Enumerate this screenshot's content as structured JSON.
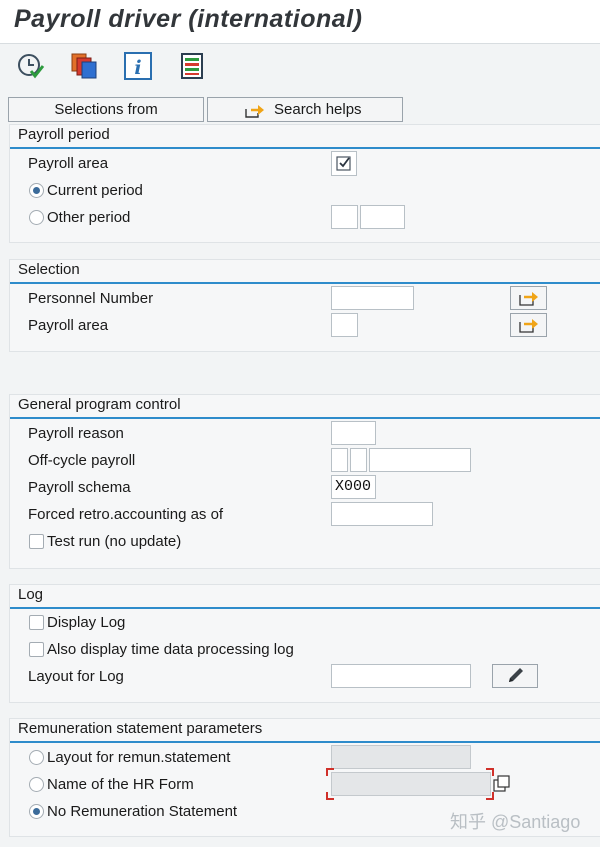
{
  "title": "Payroll driver (international)",
  "toolbar": {
    "icons": [
      "execute-clock-icon",
      "copy-variant-icon",
      "info-icon",
      "list-icon"
    ]
  },
  "buttons": {
    "selections_from": "Selections from",
    "search_helps": "Search helps"
  },
  "payroll_period": {
    "title": "Payroll period",
    "payroll_area_label": "Payroll area",
    "payroll_area_checked": true,
    "current_period_label": "Current period",
    "current_period_selected": true,
    "other_period_label": "Other period",
    "other_period_selected": false,
    "other_period_value1": "",
    "other_period_value2": ""
  },
  "selection": {
    "title": "Selection",
    "personnel_number_label": "Personnel Number",
    "personnel_number_value": "",
    "payroll_area_label": "Payroll area",
    "payroll_area_value": ""
  },
  "general": {
    "title": "General program control",
    "payroll_reason_label": "Payroll reason",
    "payroll_reason_value": "",
    "off_cycle_label": "Off-cycle payroll",
    "schema_label": "Payroll schema",
    "schema_value": "X000",
    "forced_retro_label": "Forced retro.accounting as of",
    "forced_retro_value": "",
    "test_run_label": "Test run (no update)",
    "test_run_checked": false
  },
  "log": {
    "title": "Log",
    "display_log_label": "Display Log",
    "display_log_checked": false,
    "time_log_label": "Also display time data processing log",
    "time_log_checked": false,
    "layout_label": "Layout for Log",
    "layout_value": ""
  },
  "remuneration": {
    "title": "Remuneration statement parameters",
    "layout_label": "Layout for remun.statement",
    "layout_selected": false,
    "hr_form_label": "Name of the HR Form",
    "hr_form_selected": false,
    "no_statement_label": "No Remuneration Statement",
    "no_statement_selected": true
  },
  "watermark": "知乎 @Santiago",
  "colors": {
    "accent": "#2e8ccb",
    "focus": "#d0302a",
    "arrow": "#f0a417"
  }
}
